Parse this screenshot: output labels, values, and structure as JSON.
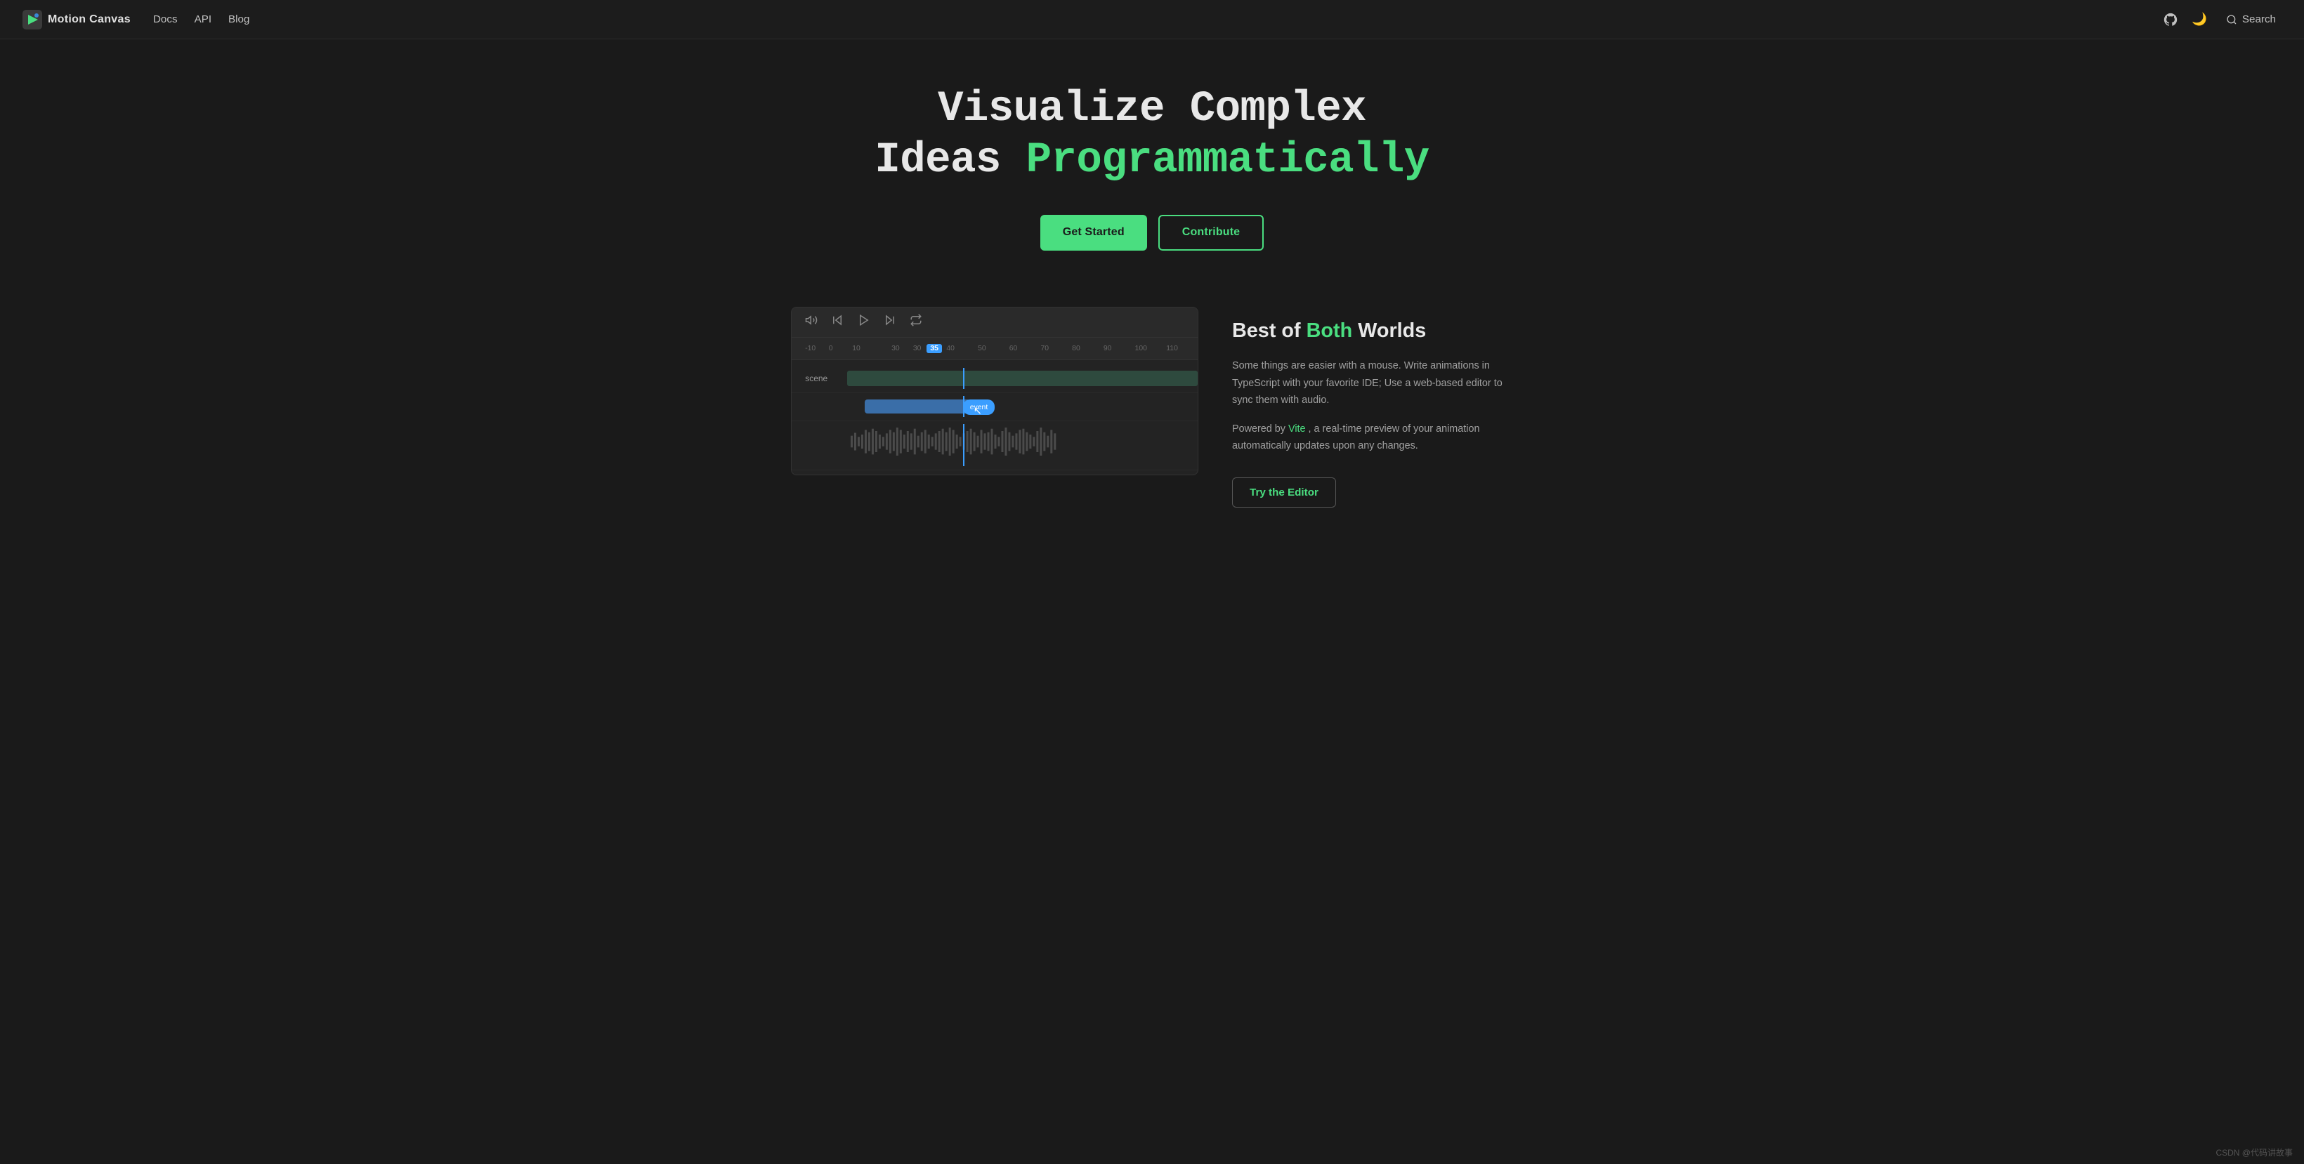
{
  "navbar": {
    "logo_text": "Motion Canvas",
    "links": [
      {
        "label": "Docs",
        "href": "#"
      },
      {
        "label": "API",
        "href": "#"
      },
      {
        "label": "Blog",
        "href": "#"
      }
    ],
    "search_label": "Search"
  },
  "hero": {
    "title_line1": "Visualize Complex",
    "title_line2_plain": "Ideas",
    "title_line2_highlight": "Programmatically",
    "btn_get_started": "Get Started",
    "btn_contribute": "Contribute"
  },
  "editor": {
    "ruler_marks": [
      "-10",
      "0",
      "10",
      "30",
      "30",
      "35",
      "40",
      "50",
      "60",
      "70",
      "80",
      "90",
      "100",
      "110"
    ],
    "playhead_value": "35",
    "track_scene_label": "scene",
    "track_event_label": "event",
    "toolbar_icons": [
      "volume",
      "skip-back",
      "play",
      "skip-forward",
      "loop"
    ]
  },
  "info": {
    "heading_plain": "Best of",
    "heading_highlight": "Both",
    "heading_end": "Worlds",
    "description1": "Some things are easier with a mouse. Write animations in TypeScript with your favorite IDE; Use a web-based editor to sync them with audio.",
    "description2_plain": "Powered by",
    "description2_link": "Vite",
    "description2_end": ", a real-time preview of your animation automatically updates upon any changes.",
    "btn_editor": "Try the Editor"
  },
  "footer": {
    "watermark": "CSDN @代码讲故事"
  }
}
